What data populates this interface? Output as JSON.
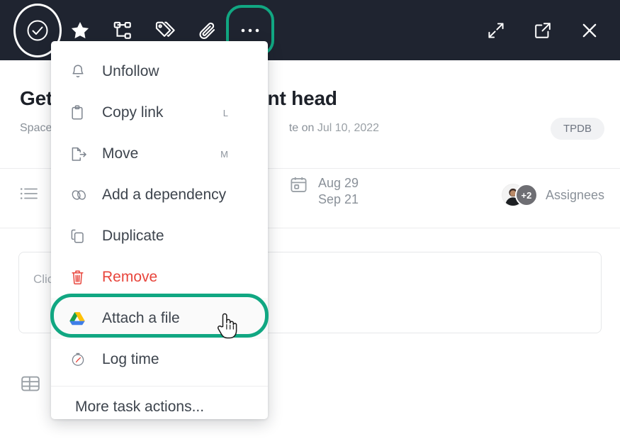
{
  "toolbar": {
    "left_icons": [
      {
        "name": "check-circle-icon",
        "label": "Complete task"
      },
      {
        "name": "star-icon",
        "label": "Favorite"
      },
      {
        "name": "subtask-icon",
        "label": "Subtasks"
      },
      {
        "name": "tag-icon",
        "label": "Tags"
      },
      {
        "name": "paperclip-icon",
        "label": "Attachments"
      },
      {
        "name": "ellipsis-icon",
        "label": "More"
      }
    ],
    "right_icons": [
      {
        "name": "expand-icon",
        "label": "Expand"
      },
      {
        "name": "open-external-icon",
        "label": "Open in new tab"
      },
      {
        "name": "close-icon",
        "label": "Close"
      }
    ],
    "highlight_color": "#11a782",
    "background_color": "#1f2430"
  },
  "task": {
    "title_visible_left": "Get",
    "title_visible_right": "rtment head",
    "subtitle_left": "Space",
    "subtitle_right_prefix": "te on ",
    "subtitle_date": "Jul 10, 2022",
    "space_badge": "TPDB"
  },
  "meta": {
    "list_icon": "list-icon",
    "calendar_icon": "calendar-icon",
    "start_date": "Aug 29",
    "due_date": "Sep 21",
    "assignees_label": "Assignees",
    "assignees_overflow": "+2"
  },
  "description": {
    "placeholder_visible": "Clic"
  },
  "footer": {
    "table_icon": "table-icon"
  },
  "menu": {
    "items": [
      {
        "label": "Unfollow",
        "icon": "bell-icon",
        "shortcut": "",
        "danger": false,
        "highlighted": false
      },
      {
        "label": "Copy link",
        "icon": "clipboard-icon",
        "shortcut": "L",
        "danger": false,
        "highlighted": false
      },
      {
        "label": "Move",
        "icon": "move-file-icon",
        "shortcut": "M",
        "danger": false,
        "highlighted": false
      },
      {
        "label": "Add a dependency",
        "icon": "link-icon",
        "shortcut": "",
        "danger": false,
        "highlighted": false
      },
      {
        "label": "Duplicate",
        "icon": "duplicate-icon",
        "shortcut": "",
        "danger": false,
        "highlighted": false
      },
      {
        "label": "Remove",
        "icon": "trash-icon",
        "shortcut": "",
        "danger": true,
        "highlighted": false
      },
      {
        "label": "Attach a file",
        "icon": "google-drive-icon",
        "shortcut": "",
        "danger": false,
        "highlighted": true
      },
      {
        "label": "Log time",
        "icon": "stopwatch-icon",
        "shortcut": "",
        "danger": false,
        "highlighted": false
      }
    ],
    "more_label": "More task actions...",
    "highlight_color": "#11a782"
  },
  "cursor": {
    "type": "pointing-hand-cursor"
  }
}
